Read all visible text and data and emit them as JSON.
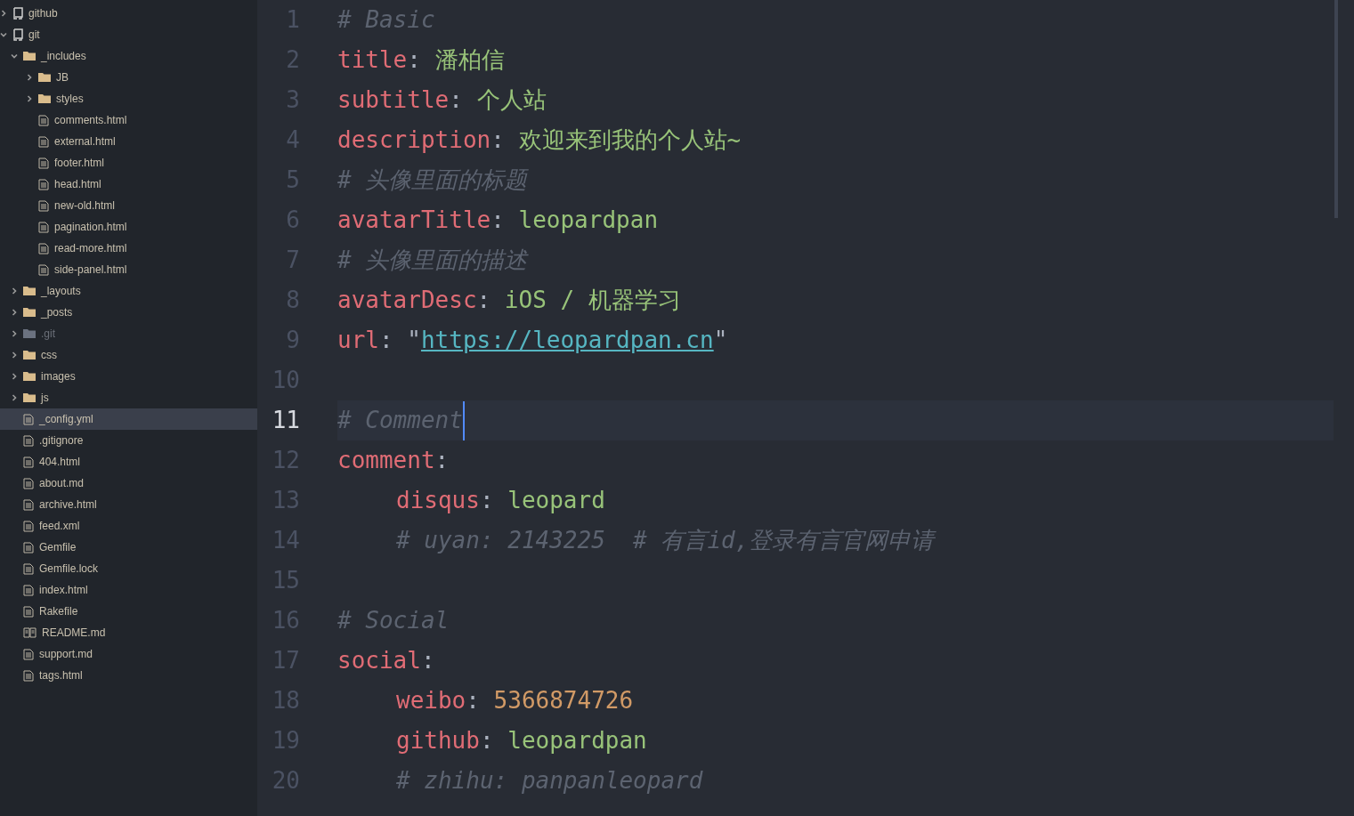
{
  "tree": [
    {
      "name": "github",
      "kind": "repo",
      "expanded": false,
      "selected": false,
      "ignored": false
    },
    {
      "name": "git",
      "kind": "repo",
      "expanded": true,
      "selected": false,
      "ignored": false,
      "children": [
        {
          "name": "_includes",
          "kind": "folder",
          "expanded": true,
          "selected": false,
          "ignored": false,
          "children": [
            {
              "name": "JB",
              "kind": "folder",
              "expanded": false,
              "selected": false,
              "ignored": false
            },
            {
              "name": "styles",
              "kind": "folder",
              "expanded": false,
              "selected": false,
              "ignored": false
            },
            {
              "name": "comments.html",
              "kind": "file",
              "selected": false,
              "ignored": false
            },
            {
              "name": "external.html",
              "kind": "file",
              "selected": false,
              "ignored": false
            },
            {
              "name": "footer.html",
              "kind": "file",
              "selected": false,
              "ignored": false
            },
            {
              "name": "head.html",
              "kind": "file",
              "selected": false,
              "ignored": false
            },
            {
              "name": "new-old.html",
              "kind": "file",
              "selected": false,
              "ignored": false
            },
            {
              "name": "pagination.html",
              "kind": "file",
              "selected": false,
              "ignored": false
            },
            {
              "name": "read-more.html",
              "kind": "file",
              "selected": false,
              "ignored": false
            },
            {
              "name": "side-panel.html",
              "kind": "file",
              "selected": false,
              "ignored": false
            }
          ]
        },
        {
          "name": "_layouts",
          "kind": "folder",
          "expanded": false,
          "selected": false,
          "ignored": false
        },
        {
          "name": "_posts",
          "kind": "folder",
          "expanded": false,
          "selected": false,
          "ignored": false
        },
        {
          "name": ".git",
          "kind": "folder",
          "expanded": false,
          "selected": false,
          "ignored": true
        },
        {
          "name": "css",
          "kind": "folder",
          "expanded": false,
          "selected": false,
          "ignored": false
        },
        {
          "name": "images",
          "kind": "folder",
          "expanded": false,
          "selected": false,
          "ignored": false
        },
        {
          "name": "js",
          "kind": "folder",
          "expanded": false,
          "selected": false,
          "ignored": false
        },
        {
          "name": "_config.yml",
          "kind": "file",
          "selected": true,
          "ignored": false
        },
        {
          "name": ".gitignore",
          "kind": "file",
          "selected": false,
          "ignored": false
        },
        {
          "name": "404.html",
          "kind": "file",
          "selected": false,
          "ignored": false
        },
        {
          "name": "about.md",
          "kind": "file",
          "selected": false,
          "ignored": false
        },
        {
          "name": "archive.html",
          "kind": "file",
          "selected": false,
          "ignored": false
        },
        {
          "name": "feed.xml",
          "kind": "file",
          "selected": false,
          "ignored": false
        },
        {
          "name": "Gemfile",
          "kind": "file",
          "selected": false,
          "ignored": false
        },
        {
          "name": "Gemfile.lock",
          "kind": "file",
          "selected": false,
          "ignored": false
        },
        {
          "name": "index.html",
          "kind": "file",
          "selected": false,
          "ignored": false
        },
        {
          "name": "Rakefile",
          "kind": "file",
          "selected": false,
          "ignored": false
        },
        {
          "name": "README.md",
          "kind": "readme",
          "selected": false,
          "ignored": false
        },
        {
          "name": "support.md",
          "kind": "file",
          "selected": false,
          "ignored": false
        },
        {
          "name": "tags.html",
          "kind": "file",
          "selected": false,
          "ignored": false
        }
      ]
    }
  ],
  "editor": {
    "lines": [
      {
        "number": "1",
        "current": false,
        "indented": false,
        "tokens": [
          {
            "kind": "comment",
            "text": "# Basic"
          }
        ]
      },
      {
        "number": "2",
        "current": false,
        "indented": false,
        "tokens": [
          {
            "kind": "key",
            "text": "title"
          },
          {
            "kind": "punct",
            "text": ": "
          },
          {
            "kind": "string",
            "text": "潘柏信"
          }
        ]
      },
      {
        "number": "3",
        "current": false,
        "indented": false,
        "tokens": [
          {
            "kind": "key",
            "text": "subtitle"
          },
          {
            "kind": "punct",
            "text": ": "
          },
          {
            "kind": "string",
            "text": "个人站"
          }
        ]
      },
      {
        "number": "4",
        "current": false,
        "indented": false,
        "tokens": [
          {
            "kind": "key",
            "text": "description"
          },
          {
            "kind": "punct",
            "text": ": "
          },
          {
            "kind": "string",
            "text": "欢迎来到我的个人站~"
          }
        ]
      },
      {
        "number": "5",
        "current": false,
        "indented": false,
        "tokens": [
          {
            "kind": "comment",
            "text": "# 头像里面的标题"
          }
        ]
      },
      {
        "number": "6",
        "current": false,
        "indented": false,
        "tokens": [
          {
            "kind": "key",
            "text": "avatarTitle"
          },
          {
            "kind": "punct",
            "text": ": "
          },
          {
            "kind": "string",
            "text": "leopardpan"
          }
        ]
      },
      {
        "number": "7",
        "current": false,
        "indented": false,
        "tokens": [
          {
            "kind": "comment",
            "text": "# 头像里面的描述"
          }
        ]
      },
      {
        "number": "8",
        "current": false,
        "indented": false,
        "tokens": [
          {
            "kind": "key",
            "text": "avatarDesc"
          },
          {
            "kind": "punct",
            "text": ": "
          },
          {
            "kind": "string",
            "text": "iOS / 机器学习"
          }
        ]
      },
      {
        "number": "9",
        "current": false,
        "indented": false,
        "tokens": [
          {
            "kind": "key",
            "text": "url"
          },
          {
            "kind": "punct",
            "text": ": \""
          },
          {
            "kind": "link",
            "text": "https://leopardpan.cn"
          },
          {
            "kind": "punct",
            "text": "\""
          }
        ]
      },
      {
        "number": "10",
        "current": false
      },
      {
        "number": "11",
        "current": true,
        "indented": false,
        "tokens": [
          {
            "kind": "comment",
            "text": "# Comment"
          }
        ]
      },
      {
        "number": "12",
        "current": false,
        "indented": false,
        "tokens": [
          {
            "kind": "key",
            "text": "comment"
          },
          {
            "kind": "punct",
            "text": ":"
          }
        ]
      },
      {
        "number": "13",
        "current": false,
        "indented": true,
        "tokens": [
          {
            "kind": "key",
            "text": "disqus"
          },
          {
            "kind": "punct",
            "text": ": "
          },
          {
            "kind": "string",
            "text": "leopard"
          }
        ]
      },
      {
        "number": "14",
        "current": false,
        "indented": true,
        "tokens": [
          {
            "kind": "comment",
            "text": "# uyan: 2143225  # 有言id,登录有言官网申请"
          }
        ]
      },
      {
        "number": "15",
        "current": false
      },
      {
        "number": "16",
        "current": false,
        "indented": false,
        "tokens": [
          {
            "kind": "comment",
            "text": "# Social"
          }
        ]
      },
      {
        "number": "17",
        "current": false,
        "indented": false,
        "tokens": [
          {
            "kind": "key",
            "text": "social"
          },
          {
            "kind": "punct",
            "text": ":"
          }
        ]
      },
      {
        "number": "18",
        "current": false,
        "indented": true,
        "tokens": [
          {
            "kind": "key",
            "text": "weibo"
          },
          {
            "kind": "punct",
            "text": ": "
          },
          {
            "kind": "number",
            "text": "5366874726"
          }
        ]
      },
      {
        "number": "19",
        "current": false,
        "indented": true,
        "tokens": [
          {
            "kind": "key",
            "text": "github"
          },
          {
            "kind": "punct",
            "text": ": "
          },
          {
            "kind": "string",
            "text": "leopardpan"
          }
        ]
      },
      {
        "number": "20",
        "current": false,
        "indented": true,
        "tokens": [
          {
            "kind": "comment",
            "text": "# zhihu: panpanleopard"
          }
        ]
      }
    ]
  }
}
